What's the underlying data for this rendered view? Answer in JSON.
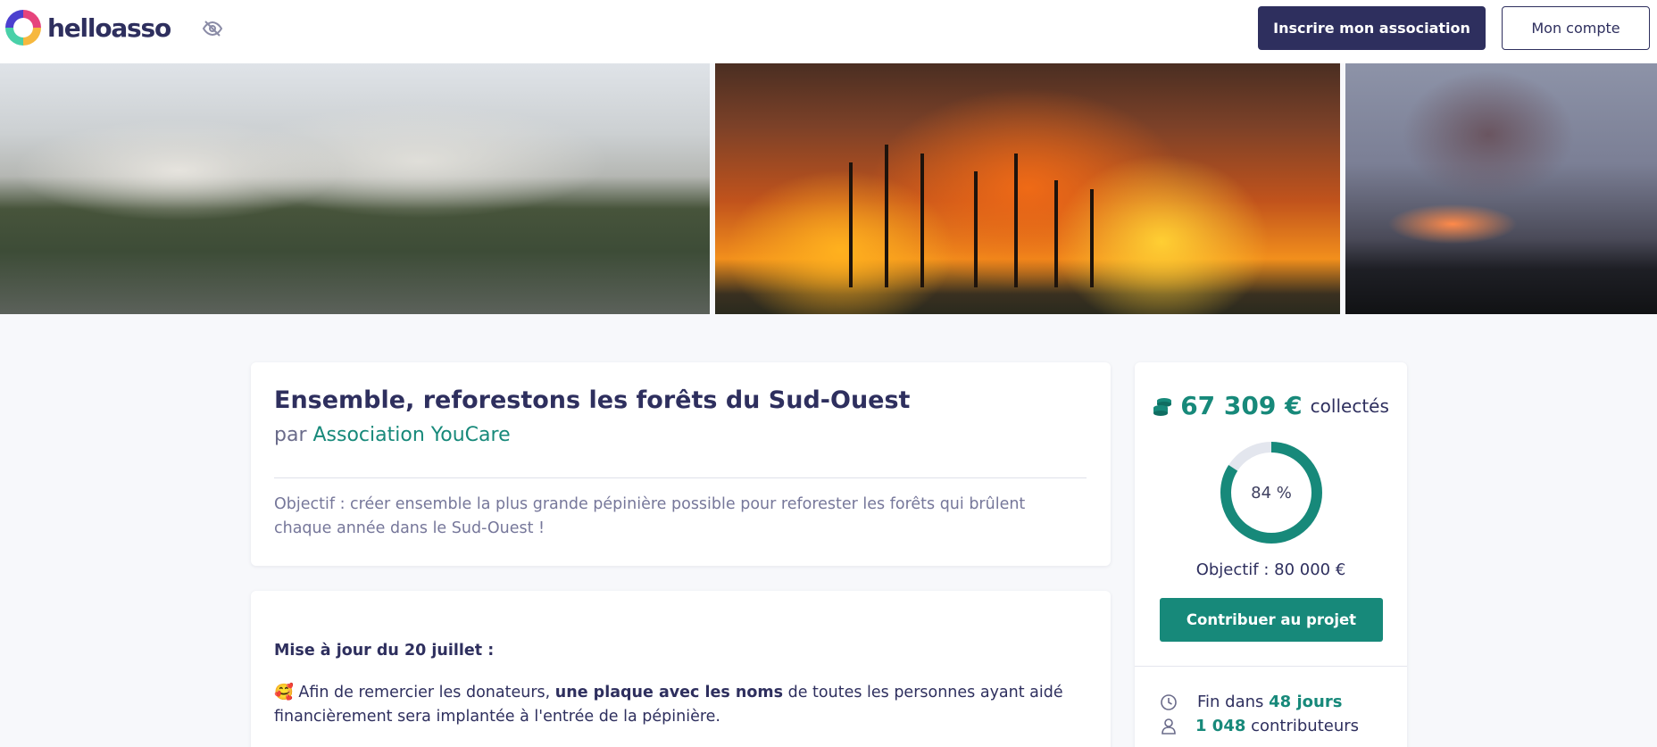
{
  "header": {
    "logo_text": "helloasso",
    "register_button": "Inscrire mon association",
    "account_button": "Mon compte",
    "icons": {
      "logo": "helloasso-logo-icon",
      "visibility": "eye-slash-icon"
    }
  },
  "campaign": {
    "title": "Ensemble, reforestons les forêts du Sud-Ouest",
    "by_prefix": "par",
    "organization": "Association YouCare",
    "objective_text": "Objectif : créer ensemble la plus grande pépinière possible pour reforester les forêts qui brûlent chaque année dans le Sud-Ouest !"
  },
  "update": {
    "heading": "Mise à jour du 20 juillet :",
    "emoji": "🥰",
    "body_part1": "Afin de remercier les donateurs,",
    "body_bold": "une plaque avec les noms",
    "body_part2": "de toutes les personnes ayant aidé financièrement sera implantée à l'entrée de la pépinière."
  },
  "funding": {
    "amount": "67 309 €",
    "amount_label": "collectés",
    "percent": 84,
    "percent_label": "84 %",
    "goal_text": "Objectif : 80 000 €",
    "contribute_button": "Contribuer au projet",
    "end_prefix": "Fin dans",
    "end_value": "48 jours",
    "contributors_value": "1 048",
    "contributors_label": "contributeurs",
    "icons": {
      "coins": "coins-icon",
      "clock": "clock-icon",
      "user": "user-icon"
    }
  },
  "colors": {
    "brand_dark": "#2e2f5e",
    "accent_green": "#17897a",
    "page_bg": "#f7f8fb"
  }
}
